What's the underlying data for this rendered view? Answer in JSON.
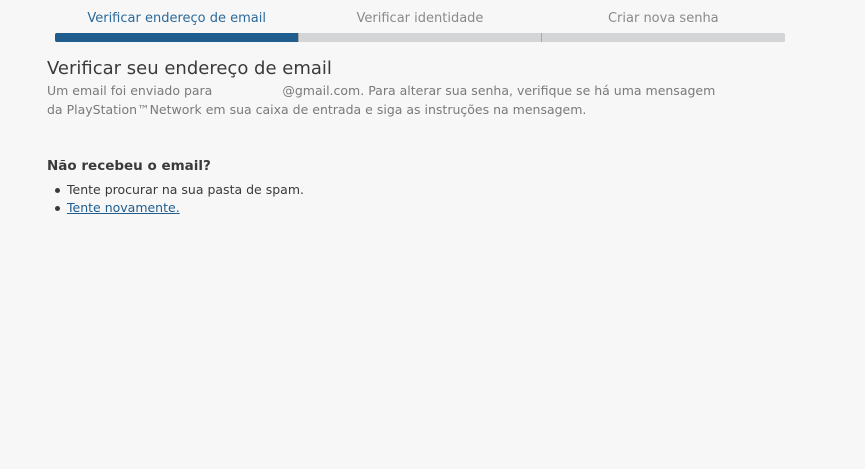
{
  "steps": [
    {
      "label": "Verificar endereço de email",
      "active": true
    },
    {
      "label": "Verificar identidade",
      "active": false
    },
    {
      "label": "Criar nova senha",
      "active": false
    }
  ],
  "main": {
    "title": "Verificar seu endereço de email",
    "message_prefix": "Um email foi enviado para",
    "email_domain": "@gmail.com.",
    "message_suffix": " Para alterar sua senha, verifique se há uma mensagem da PlayStation™Network em sua caixa de entrada e siga as instruções na mensagem.",
    "not_received_title": "Não recebeu o email?",
    "tip_spam": "Tente procurar na sua pasta de spam.",
    "retry_link": "Tente novamente."
  },
  "colors": {
    "active_step": "#1f5d8e",
    "inactive_step": "#d4d5d7",
    "link": "#1f5d8e"
  }
}
